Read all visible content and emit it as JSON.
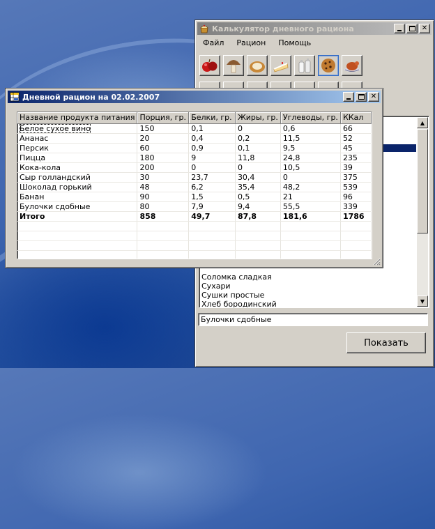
{
  "calculator": {
    "title": "Калькулятор дневного рациона",
    "menu": [
      "Файл",
      "Рацион",
      "Помощь"
    ],
    "food_icons_row1": [
      "apple-icon",
      "mushroom-icon",
      "bread-icon",
      "cake-icon",
      "milk-icon",
      "cookie-icon",
      "roast-chicken-icon"
    ],
    "list_items_visible": [
      "Соломка сладкая",
      "Сухари",
      "Сушки простые",
      "Хлеб бородинский"
    ],
    "selected_product": "Булочки сдобные",
    "show_button": "Показать"
  },
  "ration": {
    "title": "Дневной рацион на 02.02.2007",
    "columns": [
      "Название продукта питания",
      "Порция, гр.",
      "Белки, гр.",
      "Жиры, гр.",
      "Углеводы, гр.",
      "ККал"
    ],
    "rows": [
      [
        "Белое сухое вино",
        "150",
        "0,1",
        "0",
        "0,6",
        "66"
      ],
      [
        "Ананас",
        "20",
        "0,4",
        "0,2",
        "11,5",
        "52"
      ],
      [
        "Персик",
        "60",
        "0,9",
        "0,1",
        "9,5",
        "45"
      ],
      [
        "Пицца",
        "180",
        "9",
        "11,8",
        "24,8",
        "235"
      ],
      [
        "Кока-кола",
        "200",
        "0",
        "0",
        "10,5",
        "39"
      ],
      [
        "Сыр голландский",
        "30",
        "23,7",
        "30,4",
        "0",
        "375"
      ],
      [
        "Шоколад горький",
        "48",
        "6,2",
        "35,4",
        "48,2",
        "539"
      ],
      [
        "Банан",
        "90",
        "1,5",
        "0,5",
        "21",
        "96"
      ],
      [
        "Булочки сдобные",
        "80",
        "7,9",
        "9,4",
        "55,5",
        "339"
      ]
    ],
    "total": [
      "Итого",
      "858",
      "49,7",
      "87,8",
      "181,6",
      "1786"
    ]
  },
  "colors": {
    "active_title_start": "#0a246a",
    "active_title_end": "#a6caf0",
    "inactive_title_start": "#808080",
    "inactive_title_end": "#c0c0c0",
    "list_selection": "#0a246a",
    "window_face": "#d4d0c8"
  }
}
